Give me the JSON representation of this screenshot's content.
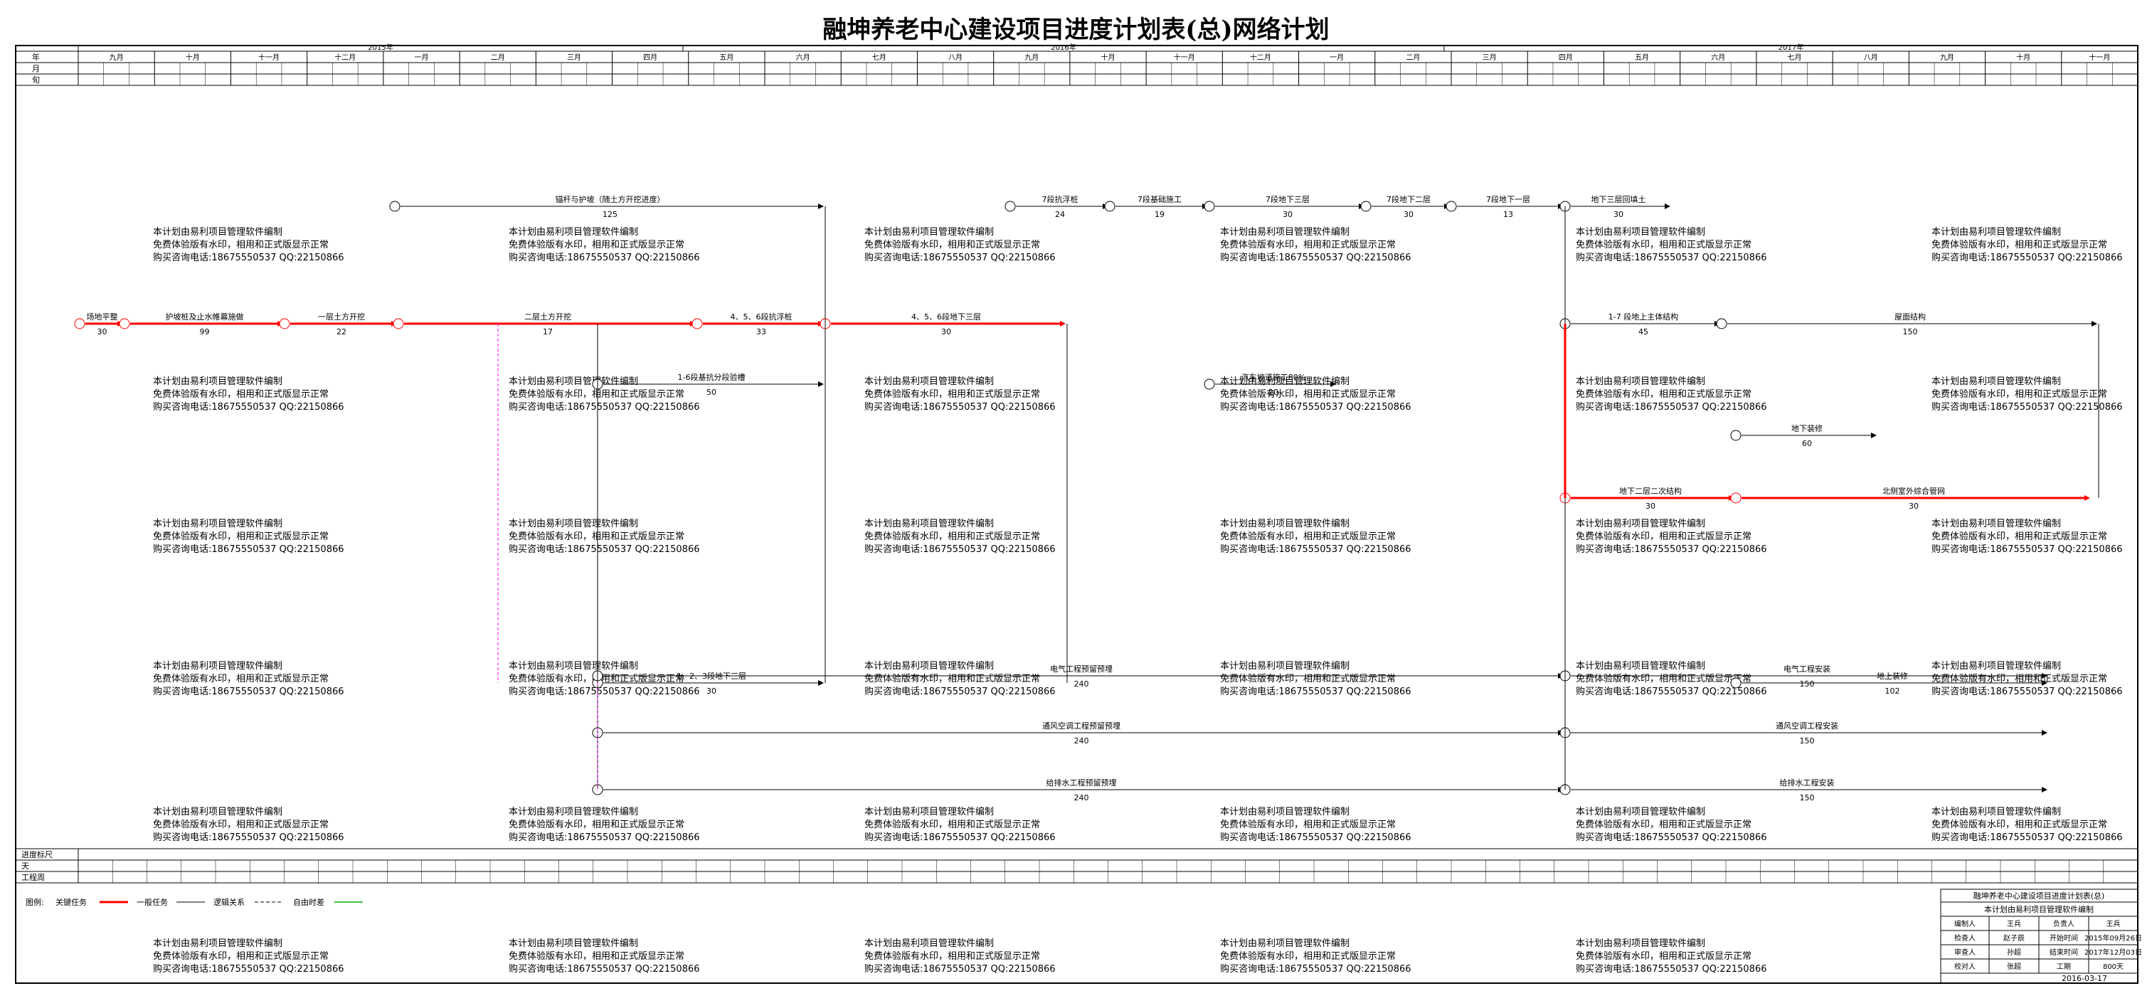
{
  "title": "融坤养老中心建设项目进度计划表(总)网络计划",
  "colors": {
    "critical": "#ff0000",
    "normal": "#000000",
    "logic": "#000000",
    "free": "#ff00ff",
    "float": "#00b000",
    "watermark": "#c8a020"
  },
  "header": {
    "row_labels": [
      "年",
      "月",
      "旬"
    ],
    "years": [
      "2015年",
      "2016年",
      "2017年"
    ],
    "months": [
      "九月",
      "十月",
      "十一月",
      "十二月",
      "一月",
      "二月",
      "三月",
      "四月",
      "五月",
      "六月",
      "七月",
      "八月",
      "九月",
      "十月",
      "十一月",
      "十二月",
      "一月",
      "二月",
      "三月",
      "四月",
      "五月",
      "六月",
      "七月",
      "八月",
      "九月",
      "十月",
      "十一月"
    ]
  },
  "watermark": {
    "line1": "本计划由易利项目管理软件编制",
    "line2": "免费体验版有水印，相用和正式版显示正常",
    "line3": "购买咨询电话:18675550537 QQ:22150866"
  },
  "activities": [
    {
      "label": "场地平整",
      "dur": "30",
      "crit": true
    },
    {
      "label": "护坡桩及止水帷幕施做",
      "dur": "99",
      "crit": true
    },
    {
      "label": "一层土方开挖",
      "dur": "22",
      "crit": true
    },
    {
      "label": "二层土方开挖",
      "dur": "17",
      "crit": true
    },
    {
      "label": "4、5、6段抗浮桩",
      "dur": "33",
      "crit": true
    },
    {
      "label": "4、5、6段地下三层",
      "dur": "30",
      "crit": true
    },
    {
      "label": "锚杆与护坡（随土方开挖进度）",
      "dur": "125",
      "crit": false
    },
    {
      "label": "1-6段基抗分段验槽",
      "dur": "50",
      "crit": false
    },
    {
      "label": "1、2、3段地下三层",
      "dur": "30",
      "crit": false
    },
    {
      "label": "7段抗浮桩",
      "dur": "24",
      "crit": false
    },
    {
      "label": "7段基础施工",
      "dur": "19",
      "crit": false
    },
    {
      "label": "7段地下三层",
      "dur": "30",
      "crit": false
    },
    {
      "label": "7段地下二层",
      "dur": "30",
      "crit": false
    },
    {
      "label": "7段地下一层",
      "dur": "13",
      "crit": false
    },
    {
      "label": "汽车坡道施工80%",
      "dur": "20",
      "crit": false
    },
    {
      "label": "1-7 段地上主体结构",
      "dur": "45",
      "crit": false
    },
    {
      "label": "屋面结构",
      "dur": "150",
      "crit": false
    },
    {
      "label": "地下三层回填土",
      "dur": "30",
      "crit": false
    },
    {
      "label": "地下二层二次结构",
      "dur": "30",
      "crit": true
    },
    {
      "label": "北侧室外综合管网",
      "dur": "30",
      "crit": true
    },
    {
      "label": "地下装修",
      "dur": "60",
      "crit": false
    },
    {
      "label": "地上装修",
      "dur": "102",
      "crit": false
    },
    {
      "label": "电气工程预留预埋",
      "dur": "240",
      "crit": false
    },
    {
      "label": "电气工程安装",
      "dur": "150",
      "crit": false
    },
    {
      "label": "通风空调工程预留预埋",
      "dur": "240",
      "crit": false
    },
    {
      "label": "通风空调工程安装",
      "dur": "150",
      "crit": false
    },
    {
      "label": "给排水工程预留预埋",
      "dur": "240",
      "crit": false
    },
    {
      "label": "给排水工程安装",
      "dur": "150",
      "crit": false
    }
  ],
  "footer": {
    "scale_label": "进度标尺",
    "day_label": "天",
    "week_label": "工程周",
    "legend_label": "图例:",
    "legend": [
      {
        "text": "关键任务",
        "color": "#ff0000"
      },
      {
        "text": "一般任务",
        "color": "#000000"
      },
      {
        "text": "逻辑关系",
        "color": "#000000"
      },
      {
        "text": "自由时差",
        "color": "#ff00ff"
      }
    ]
  },
  "info_box": {
    "title": "融坤养老中心建设项目进度计划表(总)",
    "subtitle": "本计划由易利项目管理软件编制",
    "rows": [
      [
        "编制人",
        "王兵",
        "负责人",
        "王兵"
      ],
      [
        "检查人",
        "赵子辰",
        "开始时间",
        "2015年09月26日"
      ],
      [
        "审查人",
        "孙超",
        "结束时间",
        "2017年12月03日"
      ],
      [
        "校对人",
        "张超",
        "工期",
        "800天"
      ]
    ],
    "date": "2016-03-17"
  }
}
